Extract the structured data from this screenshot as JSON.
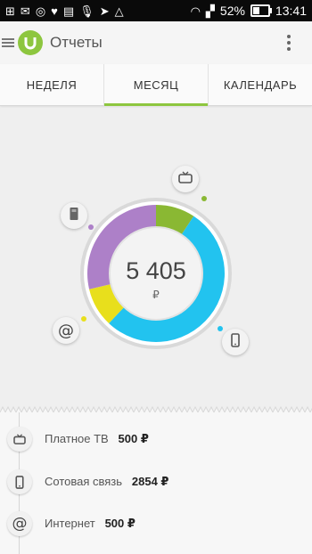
{
  "status_bar": {
    "battery_percent": "52%",
    "time": "13:41"
  },
  "app_bar": {
    "title": "Отчеты"
  },
  "tabs": [
    {
      "label": "НЕДЕЛЯ",
      "active": false
    },
    {
      "label": "МЕСЯЦ",
      "active": true
    },
    {
      "label": "КАЛЕНДАРЬ",
      "active": false
    }
  ],
  "summary": {
    "total": "5 405",
    "currency": "₽"
  },
  "chart_data": {
    "type": "pie",
    "series": [
      {
        "name": "Платное ТВ",
        "value": 500,
        "color": "#8ab833"
      },
      {
        "name": "Сотовая связь",
        "value": 2854,
        "color": "#22c3ef"
      },
      {
        "name": "Интернет",
        "value": 500,
        "color": "#e8df1c"
      },
      {
        "value": 1551,
        "color": "#ad80c8"
      }
    ],
    "total": 5405
  },
  "categories": [
    {
      "name": "Платное ТВ",
      "amount": "500 ₽",
      "icon": "tv-icon"
    },
    {
      "name": "Сотовая связь",
      "amount": "2854 ₽",
      "icon": "phone-icon"
    },
    {
      "name": "Интернет",
      "amount": "500 ₽",
      "icon": "at-icon"
    }
  ],
  "colors": {
    "accent": "#8dc63f",
    "tv": "#8ab833",
    "mobile": "#22c3ef",
    "internet": "#e8df1c",
    "other": "#ad80c8"
  }
}
